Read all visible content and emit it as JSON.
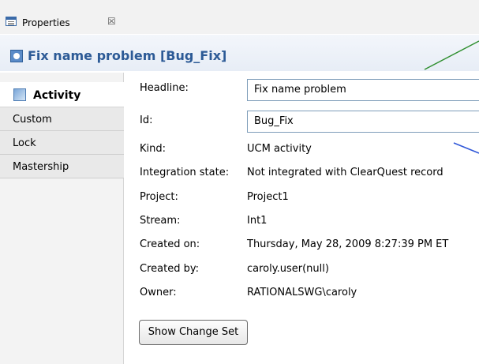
{
  "tab": {
    "label": "Properties",
    "close": "☒"
  },
  "title": {
    "text": "Fix name problem [Bug_Fix]"
  },
  "sidebar": {
    "items": [
      {
        "label": "Activity",
        "selected": true
      },
      {
        "label": "Custom"
      },
      {
        "label": "Lock"
      },
      {
        "label": "Mastership"
      }
    ]
  },
  "form": {
    "headline": {
      "label": "Headline:",
      "value": "Fix name problem"
    },
    "id": {
      "label": "Id:",
      "value": "Bug_Fix"
    },
    "kind": {
      "label": "Kind:",
      "value": "UCM activity"
    },
    "integration_state": {
      "label": "Integration state:",
      "value": "Not integrated with ClearQuest record"
    },
    "project": {
      "label": "Project:",
      "value": "Project1"
    },
    "stream": {
      "label": "Stream:",
      "value": "Int1"
    },
    "created_on": {
      "label": "Created on:",
      "value": "Thursday, May 28, 2009 8:27:39 PM ET"
    },
    "created_by": {
      "label": "Created by:",
      "value": "caroly.user(null)"
    },
    "owner": {
      "label": "Owner:",
      "value": "RATIONALSWG\\caroly"
    },
    "button": {
      "label": "Show Change Set"
    }
  },
  "colors": {
    "title": "#2c5a96",
    "green_line": "#2f8f2f",
    "blue_line": "#2f57d8"
  }
}
